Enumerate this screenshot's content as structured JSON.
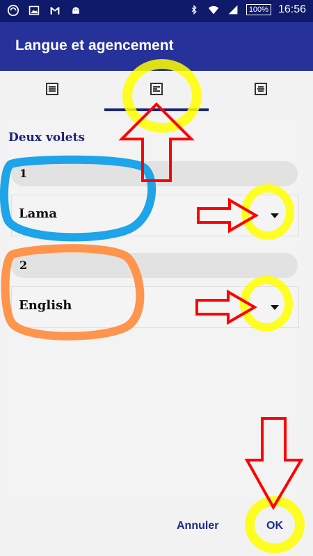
{
  "status_bar": {
    "battery": "100%",
    "time": "16:56",
    "icons": [
      "app-icon",
      "image-icon",
      "gmail-icon",
      "android-icon",
      "bluetooth-icon",
      "wifi-icon",
      "signal-icon"
    ]
  },
  "app_bar": {
    "title": "Langue et agencement"
  },
  "tabs": [
    {
      "icon": "single-pane-icon"
    },
    {
      "icon": "two-pane-icon",
      "selected": true
    },
    {
      "icon": "three-pane-icon"
    }
  ],
  "section": {
    "title": "Deux volets",
    "panes": [
      {
        "number": "1",
        "language": "Lama"
      },
      {
        "number": "2",
        "language": "English"
      }
    ]
  },
  "actions": {
    "cancel": "Annuler",
    "ok": "OK"
  },
  "annotation_colors": {
    "yellow": "#ffff00",
    "red": "#ff0000",
    "blue": "#1ea4e9",
    "orange": "#ff944d"
  }
}
